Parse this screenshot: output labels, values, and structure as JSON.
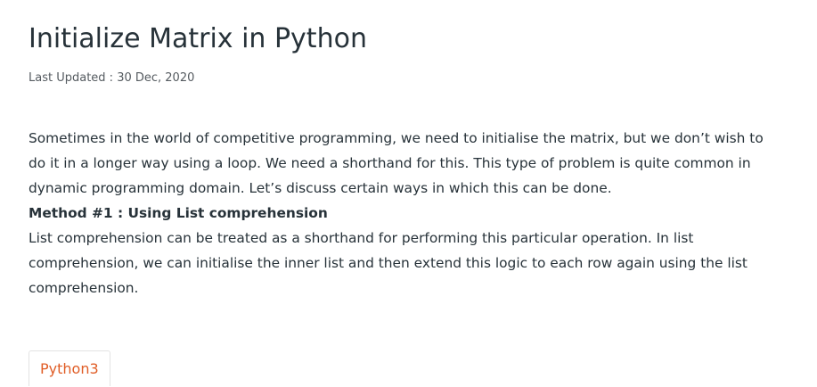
{
  "article": {
    "title": "Initialize Matrix in Python",
    "last_updated": "Last Updated : 30 Dec, 2020",
    "paragraph_1": "Sometimes in the world of competitive programming, we need to initialise the matrix, but we don’t wish to do it in a longer way using a loop. We need a shorthand for this. This type of problem is quite common in dynamic programming domain. Let’s discuss certain ways in which this can be done.",
    "method_heading": "Method #1 : Using List comprehension",
    "paragraph_2": "List comprehension can be treated as a shorthand for performing this particular operation. In list comprehension, we can initialise the inner list and then extend this logic to each row again using the list comprehension."
  },
  "tags": {
    "tag_1": "Python3"
  },
  "colors": {
    "text": "#273239",
    "meta": "#555b60",
    "tag_accent": "#e05d26",
    "tag_border": "#e3e3e3"
  }
}
